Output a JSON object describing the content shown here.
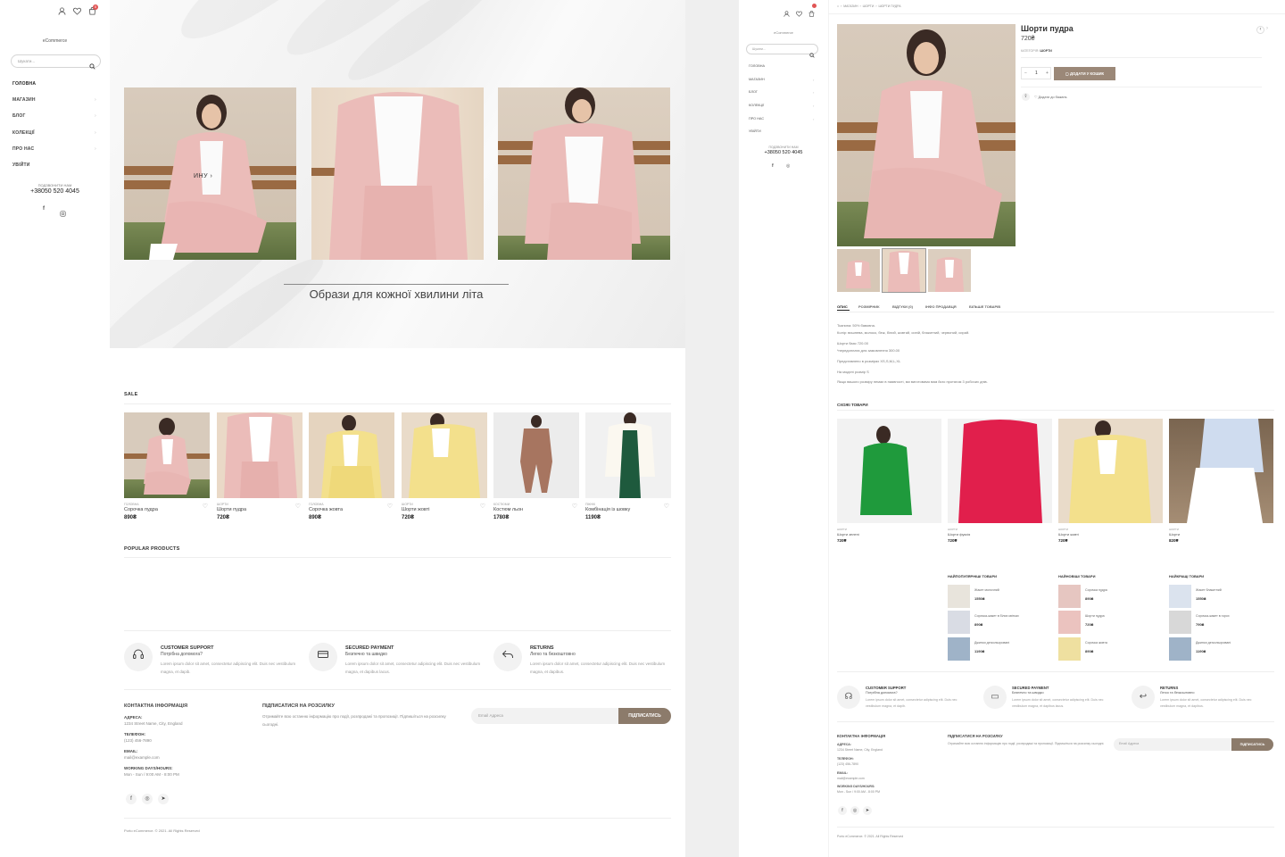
{
  "colors": {
    "accent": "#9b8878",
    "subscribe_button": "#8c7b6b",
    "cart_badge": "#e05555",
    "text": "#222222",
    "muted": "#999999"
  },
  "left": {
    "brand": "eCommerce",
    "header_icons": [
      "user-icon",
      "heart-icon",
      "cart-icon"
    ],
    "cart_count": "0",
    "search_placeholder": "Шукати...",
    "nav": [
      "ГОЛОВНА",
      "МАГАЗИН",
      "БЛОГ",
      "КОЛЕКЦІЇ",
      "ПРО НАС",
      "УВІЙТИ"
    ],
    "call_label": "ПОДЗВОНИТИ НАМ",
    "phone": "+38050 520 4045",
    "hero_link": "ИНУ",
    "hero_caption": "Образи для кожної хвилини літа",
    "sale_title": "SALE",
    "sale_products": [
      {
        "cat": "ГОЛОВНА",
        "name": "Сорочка пудра",
        "price": "890₴",
        "color": "pink"
      },
      {
        "cat": "ШОРТИ",
        "name": "Шорти пудра",
        "price": "720₴",
        "color": "pink"
      },
      {
        "cat": "ГОЛОВНА",
        "name": "Сорочка жовта",
        "price": "890₴",
        "color": "yellow"
      },
      {
        "cat": "ШОРТИ",
        "name": "Шорти жовті",
        "price": "720₴",
        "color": "yellow"
      },
      {
        "cat": "КОСТЮМИ",
        "name": "Костюм льон",
        "price": "1780₴",
        "color": "brown"
      },
      {
        "cat": "ПІКНІК",
        "name": "Комбінація із шовку",
        "price": "1190₴",
        "color": "green"
      }
    ],
    "popular_title": "POPULAR PRODUCTS",
    "features": [
      {
        "icon": "headset-icon",
        "title": "CUSTOMER SUPPORT",
        "subtitle": "Потрібна допомога?",
        "text": "Lorem ipsum dolor sit amet, consectetur adipiscing elit. Duis nec vestibulum magna, et dapib."
      },
      {
        "icon": "card-icon",
        "title": "SECURED PAYMENT",
        "subtitle": "Безпечно та швидко",
        "text": "Lorem ipsum dolor sit amet, consectetur adipiscing elit. Duis nec vestibulum magna, et dapibus lacus."
      },
      {
        "icon": "return-icon",
        "title": "RETURNS",
        "subtitle": "Легко та безкоштовно",
        "text": "Lorem ipsum dolor sit amet, consectetur adipiscing elit. Duis nec vestibulum magna, et dapibus."
      }
    ],
    "contact": {
      "title": "КОНТАКТНА ІНФОРМАЦІЯ",
      "address_label": "АДРЕСА:",
      "address": "1234 Street Name, City, England",
      "phone_label": "ТЕЛЕФОН:",
      "phone": "(123) 456-7890",
      "email_label": "EMAIL:",
      "email": "mail@example.com",
      "hours_label": "WORKING DAYS/HOURS:",
      "hours": "Mon - Sun / 9:00 AM - 8:00 PM"
    },
    "newsletter": {
      "title": "ПІДПИСАТИСЯ НА РОЗСИЛКУ",
      "text": "Отримайте всю останню інформацію про події, розпродажі та пропозиції. Підпишіться на розсилку сьогодні.",
      "placeholder": "Email Адреса",
      "button": "ПІДПИСАТИСЬ"
    },
    "copyright": "Porto eCommerce. © 2021. All Rights Reserved"
  },
  "right": {
    "brand": "eCommerce",
    "search_placeholder": "Шукати...",
    "nav": [
      "ГОЛОВНА",
      "МАГАЗИН",
      "БЛОГ",
      "КОЛЕКЦІЇ",
      "ПРО НАС",
      "УВІЙТИ"
    ],
    "call_label": "ПОДЗВОНИТИ НАМ",
    "phone": "+38050 520 4045",
    "breadcrumb": [
      "⌂",
      "МАГАЗИН",
      "ШОРТИ",
      "ШОРТИ ПУДРА"
    ],
    "product": {
      "title": "Шорти пудра",
      "price": "720₴",
      "category_label": "КАТЕГОРІЯ:",
      "category": "ШОРТИ",
      "qty": "1",
      "add_to_cart": "ДОДАТИ У КОШИК",
      "wishlist": "Додати до бажань"
    },
    "tabs": [
      "ОПИС",
      "РОЗМІРНИК",
      "ВІДГУКИ (0)",
      "ІНФО ПРОДАВЦЯ",
      "БІЛЬШЕ ТОВАРІВ"
    ],
    "description": [
      "Тканина: 50% бавовна.",
      "Колір: вишнева, молоко, беж, білий, жовтий, синій, блакитний, червоний, сирий.",
      "Шорти базя 720.00",
      "*передоплата для замовлення 300.00",
      "Представлено в розмірах XS,S,M,L,XL",
      "На моделі розмір S",
      "Якщо вашого розміру немає в наявності, ми виготовимо вам його протягом 3 робочих днів."
    ],
    "related_title": "СХОЖІ ТОВАРИ",
    "related": [
      {
        "cat": "ШОРТИ",
        "name": "Шорти зелені",
        "price": "720₴",
        "color": "green"
      },
      {
        "cat": "ШОРТИ",
        "name": "Шорти фуксія",
        "price": "720₴",
        "color": "red"
      },
      {
        "cat": "ШОРТИ",
        "name": "Шорти жовті",
        "price": "720₴",
        "color": "yellow"
      },
      {
        "cat": "ШОРТИ",
        "name": "Шорти",
        "price": "820₴",
        "color": "white"
      }
    ],
    "columns": [
      {
        "title": "НАЙПОПУЛЯРНІШІ ТОВАРИ",
        "items": [
          {
            "name": "Жакет молочний",
            "price": "1550₴"
          },
          {
            "name": "Сорочка-жакет в білих квітках",
            "price": "890₴"
          },
          {
            "name": "Джинси дегкольоровані",
            "price": "1190₴"
          }
        ]
      },
      {
        "title": "НАЙНОВІШІ ТОВАРИ",
        "items": [
          {
            "name": "Сорочка пудра",
            "price": "890₴"
          },
          {
            "name": "Шорти пудра",
            "price": "720₴"
          },
          {
            "name": "Сорочка жовта",
            "price": "890₴"
          }
        ]
      },
      {
        "title": "НАЙКРАЩІ ТОВАРИ",
        "items": [
          {
            "name": "Жакет блакитний",
            "price": "1550₴"
          },
          {
            "name": "Сорочка-жакет в горох",
            "price": "790₴"
          },
          {
            "name": "Джинси дегкольоровані",
            "price": "1190₴"
          }
        ]
      }
    ],
    "features": [
      {
        "title": "CUSTOMER SUPPORT",
        "subtitle": "Потрібна допомога?",
        "text": "Lorem ipsum dolor sit amet, consectetur adipiscing elit. Duis nec vestibulum magna, et dapib."
      },
      {
        "title": "SECURED PAYMENT",
        "subtitle": "Безпечно та швидко",
        "text": "Lorem ipsum dolor sit amet, consectetur adipiscing elit. Duis nec vestibulum magna, et dapibus lacus."
      },
      {
        "title": "RETURNS",
        "subtitle": "Легко та безкоштовно",
        "text": "Lorem ipsum dolor sit amet, consectetur adipiscing elit. Duis nec vestibulum magna, et dapibus."
      }
    ],
    "contact": {
      "title": "КОНТАКТНА ІНФОРМАЦІЯ",
      "address_label": "АДРЕСА:",
      "address": "1234 Street Name, City, England",
      "phone_label": "ТЕЛЕФОН:",
      "phone": "(123) 456-7890",
      "email_label": "EMAIL:",
      "email": "mail@example.com",
      "hours_label": "WORKING DAYS/HOURS:",
      "hours": "Mon - Sun / 9:00 AM - 8:00 PM"
    },
    "newsletter": {
      "title": "ПІДПИСАТИСЯ НА РОЗСИЛКУ",
      "text": "Отримайте всю останню інформацію про події, розпродажі та пропозиції. Підпишіться на розсилку сьогодні.",
      "placeholder": "Email Адреса",
      "button": "ПІДПИСАТИСЬ"
    },
    "copyright": "Porto eCommerce. © 2021. All Rights Reserved"
  }
}
